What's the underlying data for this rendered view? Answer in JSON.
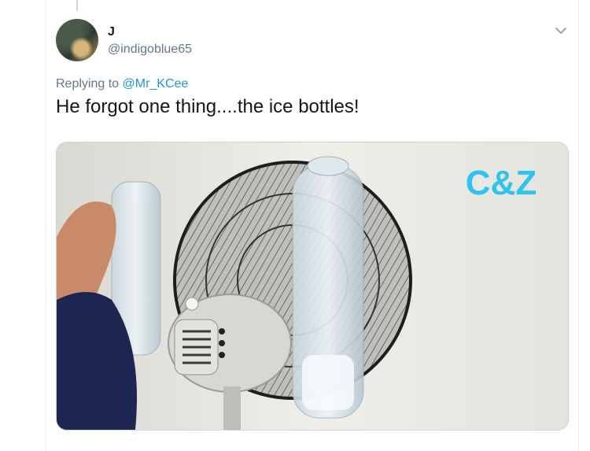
{
  "tweet": {
    "display_name": "J",
    "handle": "@indigoblue65",
    "replying_prefix": "Replying to ",
    "replying_to": "@Mr_KCee",
    "text": "He forgot one thing....the ice bottles!",
    "more_icon": "chevron-down-icon"
  },
  "media": {
    "watermark": "C&Z",
    "watermark_color": "#2ec4ef"
  },
  "colors": {
    "link": "#1b95e0",
    "secondary_text": "#657786",
    "primary_text": "#14171a",
    "border": "#e6ecf0"
  }
}
